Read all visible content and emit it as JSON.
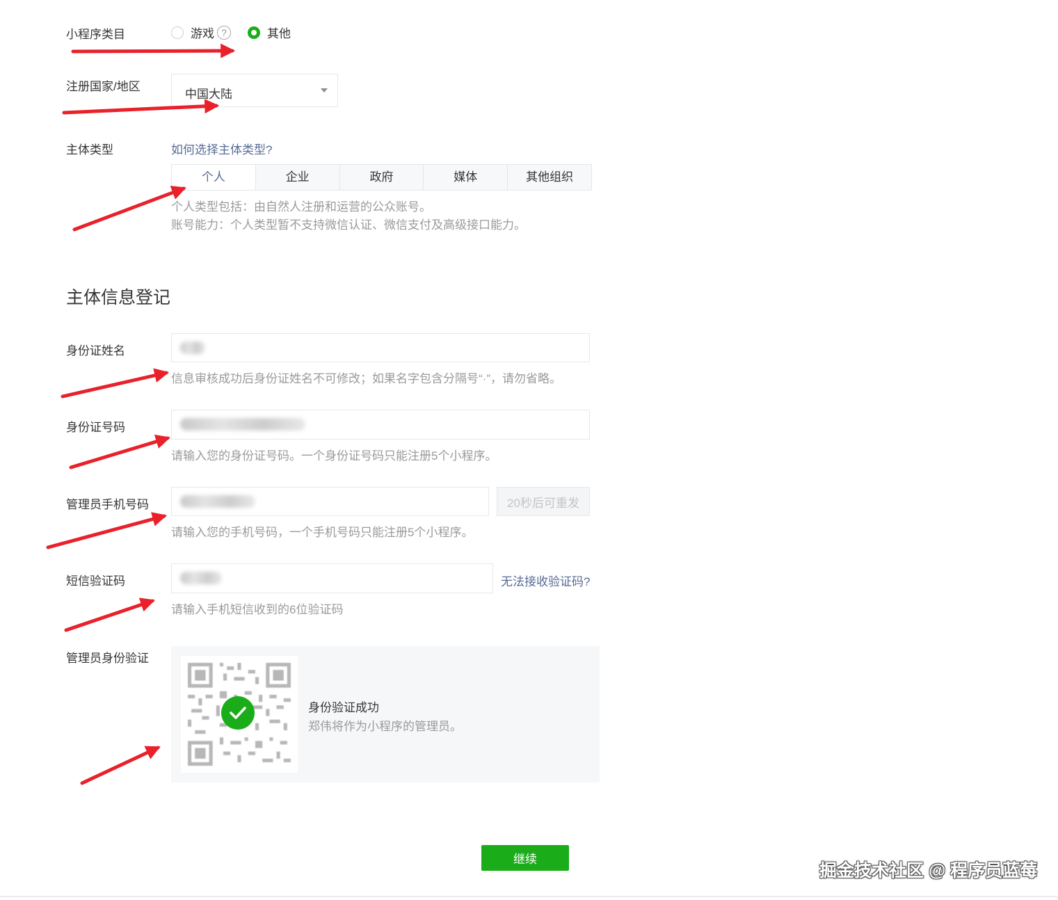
{
  "category": {
    "label": "小程序类目",
    "options": [
      {
        "label": "游戏",
        "selected": false
      },
      {
        "label": "其他",
        "selected": true
      }
    ],
    "help": "?"
  },
  "region": {
    "label": "注册国家/地区",
    "value": "中国大陆"
  },
  "entity_type": {
    "label": "主体类型",
    "help_link": "如何选择主体类型?",
    "tabs": [
      "个人",
      "企业",
      "政府",
      "媒体",
      "其他组织"
    ],
    "active_tab": "个人",
    "desc_line1": "个人类型包括：由自然人注册和运营的公众账号。",
    "desc_line2": "账号能力：个人类型暂不支持微信认证、微信支付及高级接口能力。"
  },
  "section_title": "主体信息登记",
  "id_name": {
    "label": "身份证姓名",
    "tip": "信息审核成功后身份证姓名不可修改；如果名字包含分隔号“·”，请勿省略。"
  },
  "id_number": {
    "label": "身份证号码",
    "tip": "请输入您的身份证号码。一个身份证号码只能注册5个小程序。"
  },
  "admin_phone": {
    "label": "管理员手机号码",
    "resend_label": "20秒后可重发",
    "tip": "请输入您的手机号码，一个手机号码只能注册5个小程序。"
  },
  "sms_code": {
    "label": "短信验证码",
    "help_link": "无法接收验证码?",
    "tip": "请输入手机短信收到的6位验证码"
  },
  "admin_verify": {
    "label": "管理员身份验证",
    "status_title": "身份验证成功",
    "status_desc": "郑伟将作为小程序的管理员。"
  },
  "continue_label": "继续",
  "watermark": "掘金技术社区 @ 程序员蓝莓",
  "colors": {
    "primary": "#1aad19",
    "link": "#576b95",
    "arrow": "#e8212b"
  }
}
